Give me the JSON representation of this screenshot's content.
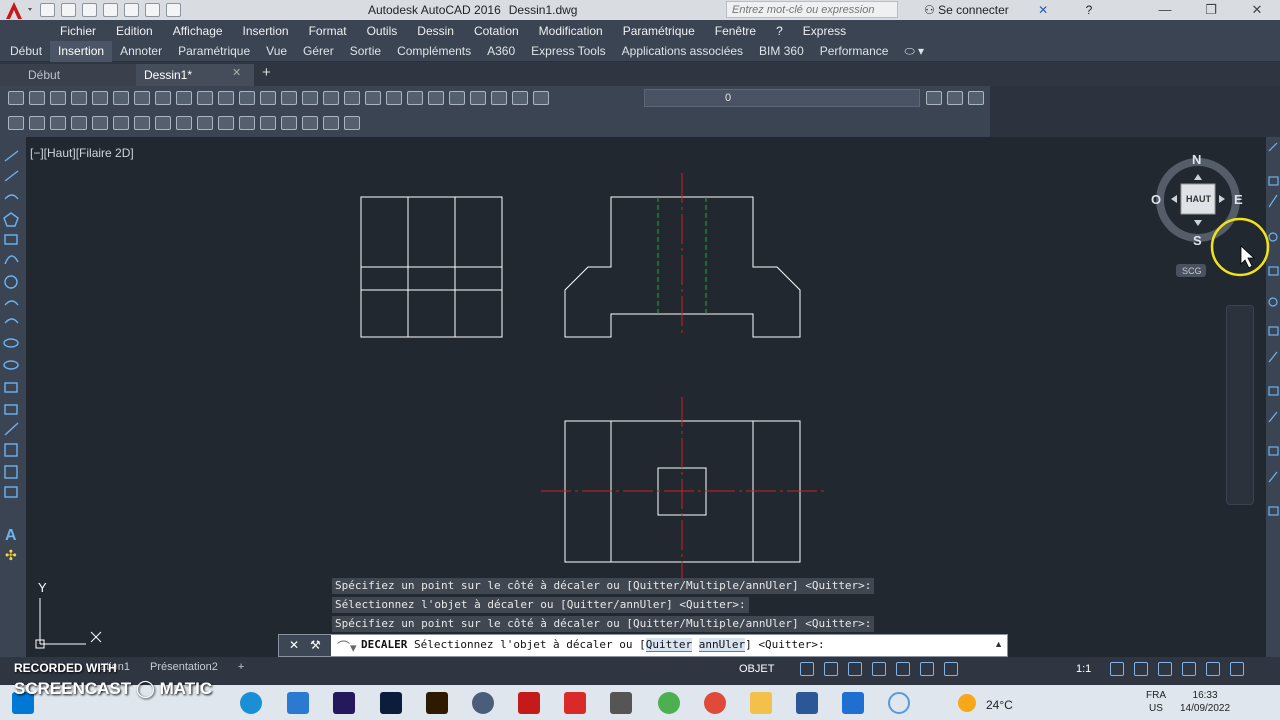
{
  "titlebar": {
    "app_title": "Autodesk AutoCAD 2016",
    "file_name": "Dessin1.dwg",
    "search_placeholder": "Entrez mot-clé ou expression",
    "signin": "Se connecter",
    "help": "?"
  },
  "menubar": [
    "Fichier",
    "Edition",
    "Affichage",
    "Insertion",
    "Format",
    "Outils",
    "Dessin",
    "Cotation",
    "Modification",
    "Paramétrique",
    "Fenêtre",
    "?",
    "Express"
  ],
  "ribbon_tabs": {
    "items": [
      "Début",
      "Insertion",
      "Annoter",
      "Paramétrique",
      "Vue",
      "Gérer",
      "Sortie",
      "Compléments",
      "A360",
      "Express Tools",
      "Applications associées",
      "BIM 360",
      "Performance"
    ],
    "active": "Insertion"
  },
  "doc_tabs": {
    "start": "Début",
    "current": "Dessin1*"
  },
  "layer_combo": "0",
  "viewport_label": "[−][Haut][Filaire 2D]",
  "viewcube": {
    "north": "N",
    "south": "S",
    "east": "E",
    "west": "O",
    "face": "HAUT",
    "ucs": "SCG"
  },
  "ucs_icon": {
    "y": "Y"
  },
  "command_history": [
    "Spécifiez un point sur le côté à décaler ou [Quitter/Multiple/annUler] <Quitter>:",
    "Sélectionnez l'objet à décaler ou [Quitter/annUler] <Quitter>:",
    "Spécifiez un point sur le côté à décaler ou [Quitter/Multiple/annUler] <Quitter>:"
  ],
  "command_line": {
    "command": "DECALER",
    "prompt": "Sélectionnez l'objet à décaler ou [",
    "option1": "Quitter",
    "option2": "annUler",
    "suffix": "] <Quitter>:"
  },
  "layout_tabs": [
    "ation1",
    "Présentation2"
  ],
  "status": {
    "space": "OBJET",
    "scale": "1:1"
  },
  "watermark": {
    "line1": "RECORDED WITH",
    "line2": "SCREENCAST ◯ MATIC"
  },
  "taskbar": {
    "temperature": "24°C",
    "lang1": "FRA",
    "lang2": "US",
    "time": "16:33",
    "date": "14/09/2022"
  },
  "colors": {
    "background": "#212830",
    "lines": "#ffffff",
    "axis": "#d0202a",
    "hidden": "#1fae3a",
    "ui_panel": "#3b4453"
  }
}
